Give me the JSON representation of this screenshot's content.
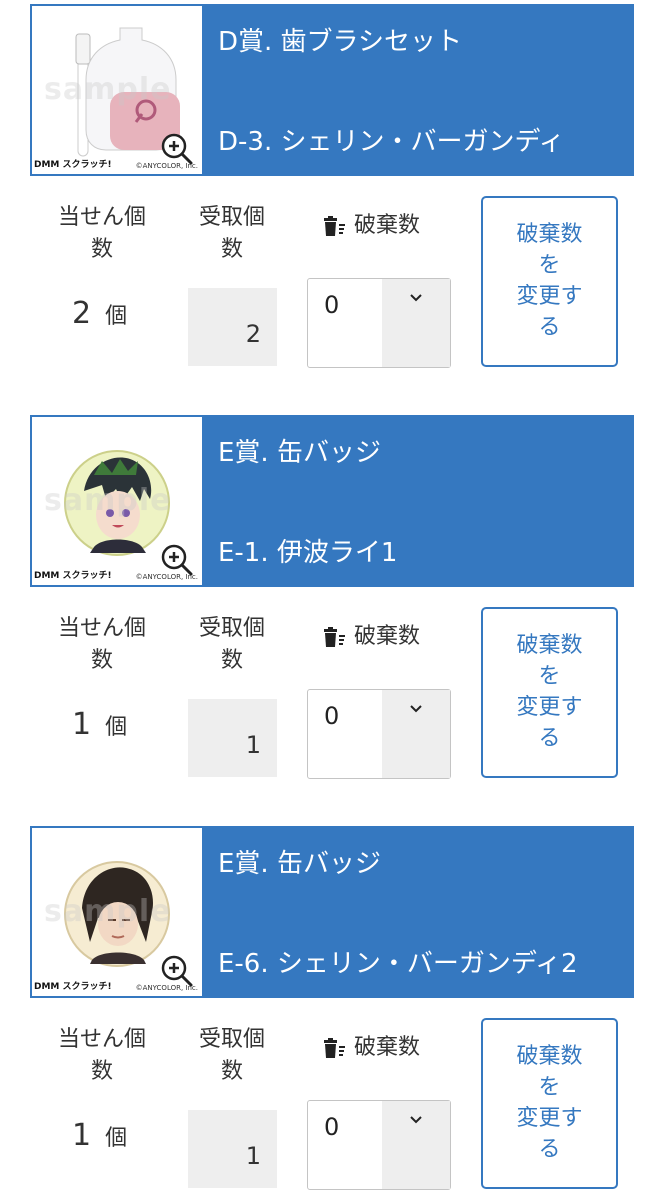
{
  "labels": {
    "won_count": "当せん個数",
    "won_count_line1": "当せん個",
    "won_count_line2": "数",
    "received_count_line1": "受取個",
    "received_count_line2": "数",
    "discard_count": "破棄数",
    "unit": "個",
    "change_discard_line1": "破棄数",
    "change_discard_line2": "を",
    "change_discard_line3": "変更す",
    "change_discard_line4": "る"
  },
  "thumbnail": {
    "brand": "DMM スクラッチ!",
    "copyright": "©ANYCOLOR, Inc.",
    "watermark": "sample"
  },
  "items": [
    {
      "prize": "D賞. 歯ブラシセット",
      "variant": "D-3. シェリン・バーガンディ",
      "won": "2",
      "received": "2",
      "discard": "0"
    },
    {
      "prize": "E賞. 缶バッジ",
      "variant": "E-1. 伊波ライ1",
      "won": "1",
      "received": "1",
      "discard": "0"
    },
    {
      "prize": "E賞. 缶バッジ",
      "variant": "E-6. シェリン・バーガンディ2",
      "won": "1",
      "received": "1",
      "discard": "0"
    }
  ],
  "colors": {
    "accent": "#3578c0",
    "field_bg": "#eeeeee"
  }
}
